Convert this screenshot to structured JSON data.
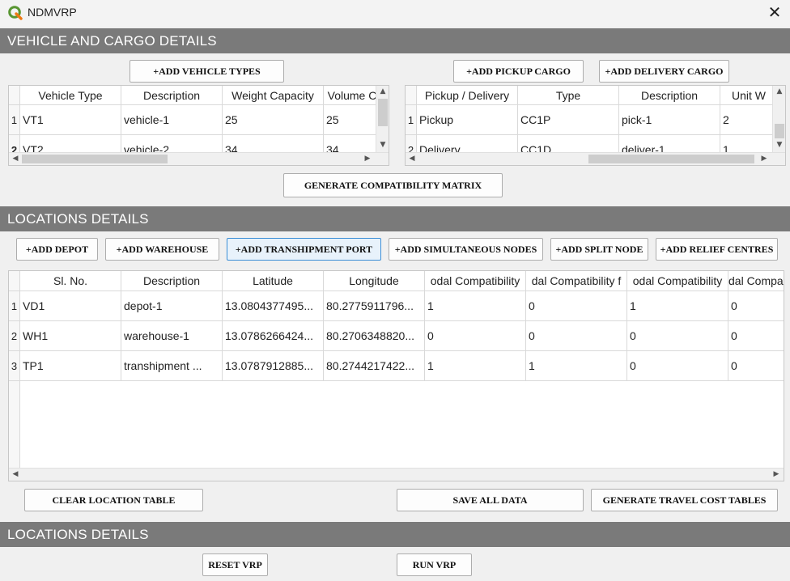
{
  "window": {
    "title": "NDMVRP",
    "close_icon": "close-icon"
  },
  "sections": {
    "vehicle_cargo": "VEHICLE AND CARGO DETAILS",
    "locations": "LOCATIONS DETAILS",
    "locations2": "LOCATIONS DETAILS"
  },
  "buttons": {
    "add_vehicle_types": "+ADD VEHICLE TYPES",
    "add_pickup_cargo": "+ADD PICKUP CARGO",
    "add_delivery_cargo": "+ADD DELIVERY CARGO",
    "generate_compat": "GENERATE COMPATIBILITY MATRIX",
    "add_depot": "+ADD DEPOT",
    "add_warehouse": "+ADD WAREHOUSE",
    "add_transhipment": "+ADD TRANSHIPMENT PORT",
    "add_simultaneous": "+ADD SIMULTANEOUS NODES",
    "add_split": "+ADD SPLIT NODE",
    "add_relief": "+ADD RELIEF CENTRES",
    "clear_location": "CLEAR LOCATION TABLE",
    "save_all": "SAVE ALL DATA",
    "gen_travel": "GENERATE TRAVEL COST TABLES",
    "reset_vrp": "RESET VRP",
    "run_vrp": "RUN VRP"
  },
  "vehicle_table": {
    "headers": [
      "Vehicle Type",
      "Description",
      "Weight Capacity",
      "Volume C"
    ],
    "row_numbers": [
      "1",
      "2"
    ],
    "rows": [
      [
        "VT1",
        "vehicle-1",
        "25",
        "25"
      ],
      [
        "VT2",
        "vehicle-2",
        "34",
        "34"
      ]
    ]
  },
  "cargo_table": {
    "headers": [
      "Pickup / Delivery",
      "Type",
      "Description",
      "Unit W"
    ],
    "row_numbers": [
      "1",
      "2"
    ],
    "rows": [
      [
        "Pickup",
        "CC1P",
        "pick-1",
        "2"
      ],
      [
        "Delivery",
        "CC1D",
        "deliver-1",
        "1"
      ]
    ]
  },
  "location_table": {
    "headers": [
      "Sl. No.",
      "Description",
      "Latitude",
      "Longitude",
      "odal Compatibility",
      "dal Compatibility f",
      "odal Compatibility",
      "dal Compa"
    ],
    "row_numbers": [
      "1",
      "2",
      "3"
    ],
    "rows": [
      [
        "VD1",
        "depot-1",
        "13.0804377495...",
        "80.2775911796...",
        "1",
        "0",
        "1",
        "0"
      ],
      [
        "WH1",
        "warehouse-1",
        "13.0786266424...",
        "80.2706348820...",
        "0",
        "0",
        "0",
        "0"
      ],
      [
        "TP1",
        "transhipment ...",
        "13.0787912885...",
        "80.2744217422...",
        "1",
        "1",
        "0",
        "0"
      ]
    ]
  },
  "colors": {
    "section_bar": "#7a7a7a",
    "logo_green": "#589632",
    "logo_yellow": "#ee7913"
  }
}
